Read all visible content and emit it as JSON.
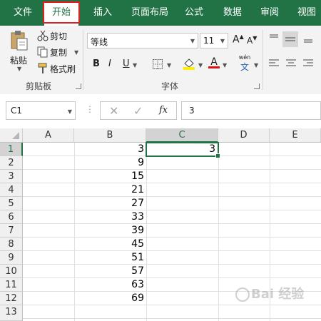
{
  "ribbon_tabs": [
    "文件",
    "开始",
    "插入",
    "页面布局",
    "公式",
    "数据",
    "审阅",
    "视图"
  ],
  "clipboard": {
    "paste_label": "粘贴",
    "cut_label": "剪切",
    "copy_label": "复制",
    "format_painter_label": "格式刷",
    "group_label": "剪贴板"
  },
  "font": {
    "font_name": "等线",
    "font_size": "11",
    "grow_label": "A",
    "shrink_label": "A",
    "bold_label": "B",
    "italic_label": "I",
    "underline_label": "U",
    "font_color_label": "A",
    "phonetic_label": "wén",
    "phonetic_sub": "文",
    "group_label": "字体"
  },
  "formula_bar": {
    "name_box": "C1",
    "fx_label": "fx",
    "formula": "3"
  },
  "sheet": {
    "columns": [
      "A",
      "B",
      "C",
      "D",
      "E"
    ],
    "rows": [
      "1",
      "2",
      "3",
      "4",
      "5",
      "6",
      "7",
      "8",
      "9",
      "10",
      "11",
      "12",
      "13"
    ],
    "column_b_values": [
      "3",
      "9",
      "15",
      "21",
      "27",
      "33",
      "39",
      "45",
      "51",
      "57",
      "63",
      "69"
    ],
    "c1_value": "3"
  },
  "watermark": {
    "text": "Bai 经验"
  },
  "colors": {
    "excel_green": "#217346",
    "tab_highlight_border": "#e02020",
    "font_color_bar": "#e01010",
    "highlight_bar": "#ffee00"
  }
}
